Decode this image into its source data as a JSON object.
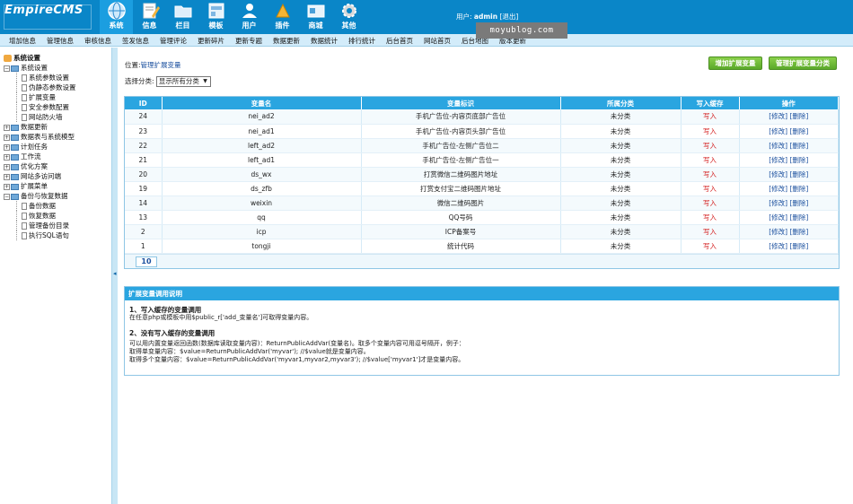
{
  "header": {
    "logo_text": "EmpireCMS",
    "user_prefix": "用户:",
    "username": "admin",
    "logout": "[退出]",
    "watermark": "moyublog.com",
    "modules": [
      {
        "label": "系统",
        "icon": "globe-icon",
        "active": true
      },
      {
        "label": "信息",
        "icon": "edit-icon"
      },
      {
        "label": "栏目",
        "icon": "folder-icon"
      },
      {
        "label": "模板",
        "icon": "template-icon"
      },
      {
        "label": "用户",
        "icon": "user-icon"
      },
      {
        "label": "插件",
        "icon": "plugin-icon"
      },
      {
        "label": "商城",
        "icon": "shop-icon"
      },
      {
        "label": "其他",
        "icon": "gear-icon"
      }
    ]
  },
  "subnav": [
    "增加信息",
    "管理信息",
    "审核信息",
    "签发信息",
    "管理评论",
    "更新碎片",
    "更新专题",
    "数据更新",
    "数据统计",
    "排行统计",
    "后台首页",
    "网站首页",
    "后台地图",
    "版本更新"
  ],
  "sidebar": {
    "root": "系统设置",
    "items": [
      {
        "label": "系统设置",
        "level": 1,
        "open": true
      },
      {
        "label": "系统参数设置",
        "level": 2
      },
      {
        "label": "伪静态参数设置",
        "level": 2
      },
      {
        "label": "扩展变量",
        "level": 2
      },
      {
        "label": "安全参数配置",
        "level": 2
      },
      {
        "label": "网站防火墙",
        "level": 2
      },
      {
        "label": "数据更新",
        "level": 1
      },
      {
        "label": "数据表与系统模型",
        "level": 1
      },
      {
        "label": "计划任务",
        "level": 1
      },
      {
        "label": "工作流",
        "level": 1
      },
      {
        "label": "优化方案",
        "level": 1
      },
      {
        "label": "网站多访问端",
        "level": 1
      },
      {
        "label": "扩展菜单",
        "level": 1
      },
      {
        "label": "备份与恢复数据",
        "level": 1,
        "open": true
      },
      {
        "label": "备份数据",
        "level": 2
      },
      {
        "label": "恢复数据",
        "level": 2
      },
      {
        "label": "管理备份目录",
        "level": 2
      },
      {
        "label": "执行SQL语句",
        "level": 2
      }
    ]
  },
  "main": {
    "breadcrumb_prefix": "位置:",
    "breadcrumb_link": "管理扩展变量",
    "filter_label": "选择分类:",
    "filter_value": "显示所有分类",
    "btn_add": "增加扩展变量",
    "btn_class": "管理扩展变量分类",
    "columns": [
      "ID",
      "变量名",
      "变量标识",
      "所属分类",
      "写入缓存",
      "操作"
    ],
    "rows": [
      [
        "24",
        "nei_ad2",
        "手机广告位-内容页底部广告位",
        "未分类",
        "写入",
        "[修改] [删除]"
      ],
      [
        "23",
        "nei_ad1",
        "手机广告位-内容页头部广告位",
        "未分类",
        "写入",
        "[修改] [删除]"
      ],
      [
        "22",
        "left_ad2",
        "手机广告位-左侧广告位二",
        "未分类",
        "写入",
        "[修改] [删除]"
      ],
      [
        "21",
        "left_ad1",
        "手机广告位-左侧广告位一",
        "未分类",
        "写入",
        "[修改] [删除]"
      ],
      [
        "20",
        "ds_wx",
        "打赏微信二维码图片地址",
        "未分类",
        "写入",
        "[修改] [删除]"
      ],
      [
        "19",
        "ds_zfb",
        "打赏支付宝二维码图片地址",
        "未分类",
        "写入",
        "[修改] [删除]"
      ],
      [
        "14",
        "weixin",
        "微信二维码图片",
        "未分类",
        "写入",
        "[修改] [删除]"
      ],
      [
        "13",
        "qq",
        "QQ号码",
        "未分类",
        "写入",
        "[修改] [删除]"
      ],
      [
        "2",
        "icp",
        "ICP备案号",
        "未分类",
        "写入",
        "[修改] [删除]"
      ],
      [
        "1",
        "tongji",
        "统计代码",
        "未分类",
        "写入",
        "[修改] [删除]"
      ]
    ],
    "pager": "10"
  },
  "help": {
    "title": "扩展变量调用说明",
    "s1_title": "1、写入缓存的变量调用",
    "s1_text": "在任意php或模板中用$public_r['add_变量名']可取得变量内容。",
    "s2_title": "2、没有写入缓存的变量调用",
    "s2_l1": "可以用内置变量返回函数(数据库读取变量内容)：ReturnPublicAddVar(变量名)。取多个变量内容可用逗号隔开，例子：",
    "s2_l2": "取得单变量内容：$value=ReturnPublicAddVar('myvar'); //$value就是变量内容。",
    "s2_l3": "取得多个变量内容：$value=ReturnPublicAddVar('myvar1,myvar2,myvar3'); //$value['myvar1']才是变量内容。"
  }
}
